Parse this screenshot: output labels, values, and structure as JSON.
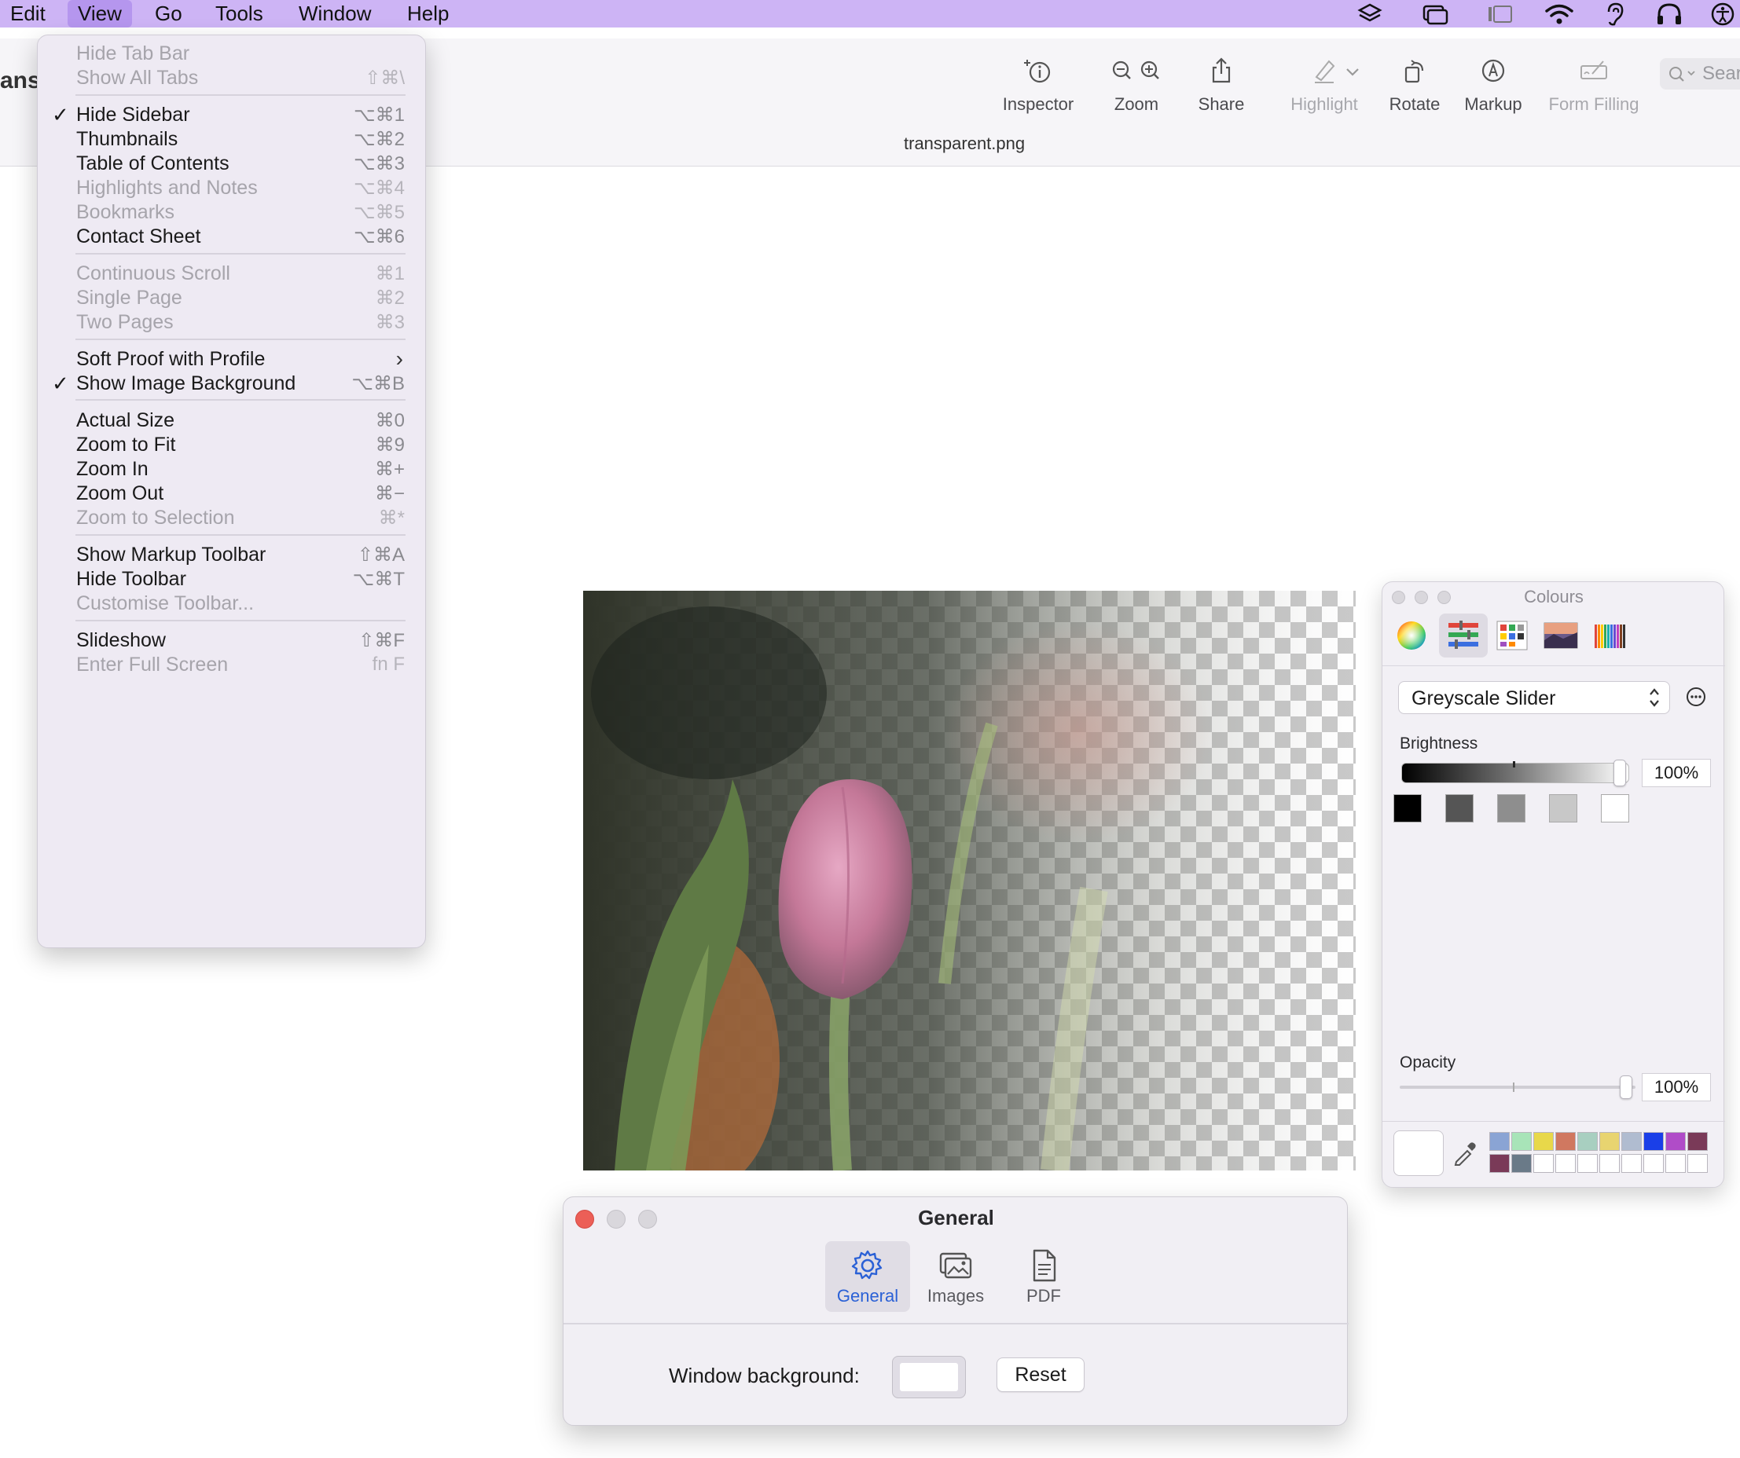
{
  "menubar": {
    "items": [
      {
        "label": "Edit"
      },
      {
        "label": "View"
      },
      {
        "label": "Go"
      },
      {
        "label": "Tools"
      },
      {
        "label": "Window"
      },
      {
        "label": "Help"
      }
    ],
    "active": "View"
  },
  "app": {
    "title_fragment": "ans",
    "document_title": "transparent.png",
    "search_placeholder": "Sear"
  },
  "toolbar": {
    "inspector": "Inspector",
    "zoom": "Zoom",
    "share": "Share",
    "highlight": "Highlight",
    "rotate": "Rotate",
    "markup": "Markup",
    "form_filling": "Form Filling"
  },
  "view_menu": {
    "items": [
      {
        "label": "Hide Tab Bar",
        "shortcut": "",
        "enabled": false,
        "checked": false
      },
      {
        "label": "Show All Tabs",
        "shortcut": "⇧⌘\\",
        "enabled": false,
        "checked": false
      },
      {
        "label": "Hide Sidebar",
        "shortcut": "⌥⌘1",
        "enabled": true,
        "checked": true
      },
      {
        "label": "Thumbnails",
        "shortcut": "⌥⌘2",
        "enabled": true,
        "checked": false
      },
      {
        "label": "Table of Contents",
        "shortcut": "⌥⌘3",
        "enabled": true,
        "checked": false
      },
      {
        "label": "Highlights and Notes",
        "shortcut": "⌥⌘4",
        "enabled": false,
        "checked": false
      },
      {
        "label": "Bookmarks",
        "shortcut": "⌥⌘5",
        "enabled": false,
        "checked": false
      },
      {
        "label": "Contact Sheet",
        "shortcut": "⌥⌘6",
        "enabled": true,
        "checked": false
      },
      {
        "label": "Continuous Scroll",
        "shortcut": "⌘1",
        "enabled": false,
        "checked": false
      },
      {
        "label": "Single Page",
        "shortcut": "⌘2",
        "enabled": false,
        "checked": false
      },
      {
        "label": "Two Pages",
        "shortcut": "⌘3",
        "enabled": false,
        "checked": false
      },
      {
        "label": "Soft Proof with Profile",
        "shortcut": "",
        "enabled": true,
        "checked": false,
        "submenu": true
      },
      {
        "label": "Show Image Background",
        "shortcut": "⌥⌘B",
        "enabled": true,
        "checked": true
      },
      {
        "label": "Actual Size",
        "shortcut": "⌘0",
        "enabled": true,
        "checked": false
      },
      {
        "label": "Zoom to Fit",
        "shortcut": "⌘9",
        "enabled": true,
        "checked": false
      },
      {
        "label": "Zoom In",
        "shortcut": "⌘+",
        "enabled": true,
        "checked": false
      },
      {
        "label": "Zoom Out",
        "shortcut": "⌘−",
        "enabled": true,
        "checked": false
      },
      {
        "label": "Zoom to Selection",
        "shortcut": "⌘*",
        "enabled": false,
        "checked": false
      },
      {
        "label": "Show Markup Toolbar",
        "shortcut": "⇧⌘A",
        "enabled": true,
        "checked": false
      },
      {
        "label": "Hide Toolbar",
        "shortcut": "⌥⌘T",
        "enabled": true,
        "checked": false
      },
      {
        "label": "Customise Toolbar...",
        "shortcut": "",
        "enabled": false,
        "checked": false
      },
      {
        "label": "Slideshow",
        "shortcut": "⇧⌘F",
        "enabled": true,
        "checked": false
      },
      {
        "label": "Enter Full Screen",
        "shortcut": "fn F",
        "enabled": false,
        "checked": false
      }
    ],
    "check_glyph": "✓",
    "submenu_glyph": "›"
  },
  "colours_panel": {
    "title": "Colours",
    "mode": "Greyscale Slider",
    "brightness_label": "Brightness",
    "brightness_value": "100%",
    "brightness_level": 1.0,
    "opacity_label": "Opacity",
    "opacity_value": "100%",
    "opacity_level": 1.0,
    "grey_swatches": [
      "#000000",
      "#555555",
      "#8e8e8e",
      "#c8c8c8",
      "#ffffff"
    ],
    "palette_row1": [
      "#8aa4d4",
      "#a8e4b8",
      "#e8d84a",
      "#d07860",
      "#a8cfc0",
      "#e8d470",
      "#b0bcd0",
      "#1a3fe8",
      "#b04cc8",
      "#7a3a58"
    ],
    "palette_row2": [
      "#7a3a58",
      "#6a7a88"
    ]
  },
  "general_window": {
    "title": "General",
    "tabs": [
      {
        "label": "General",
        "icon": "gear-icon",
        "selected": true
      },
      {
        "label": "Images",
        "icon": "images-icon",
        "selected": false
      },
      {
        "label": "PDF",
        "icon": "pdf-document-icon",
        "selected": false
      }
    ],
    "window_background_label": "Window background:",
    "reset_label": "Reset",
    "accent_color": "#2b61d6"
  }
}
